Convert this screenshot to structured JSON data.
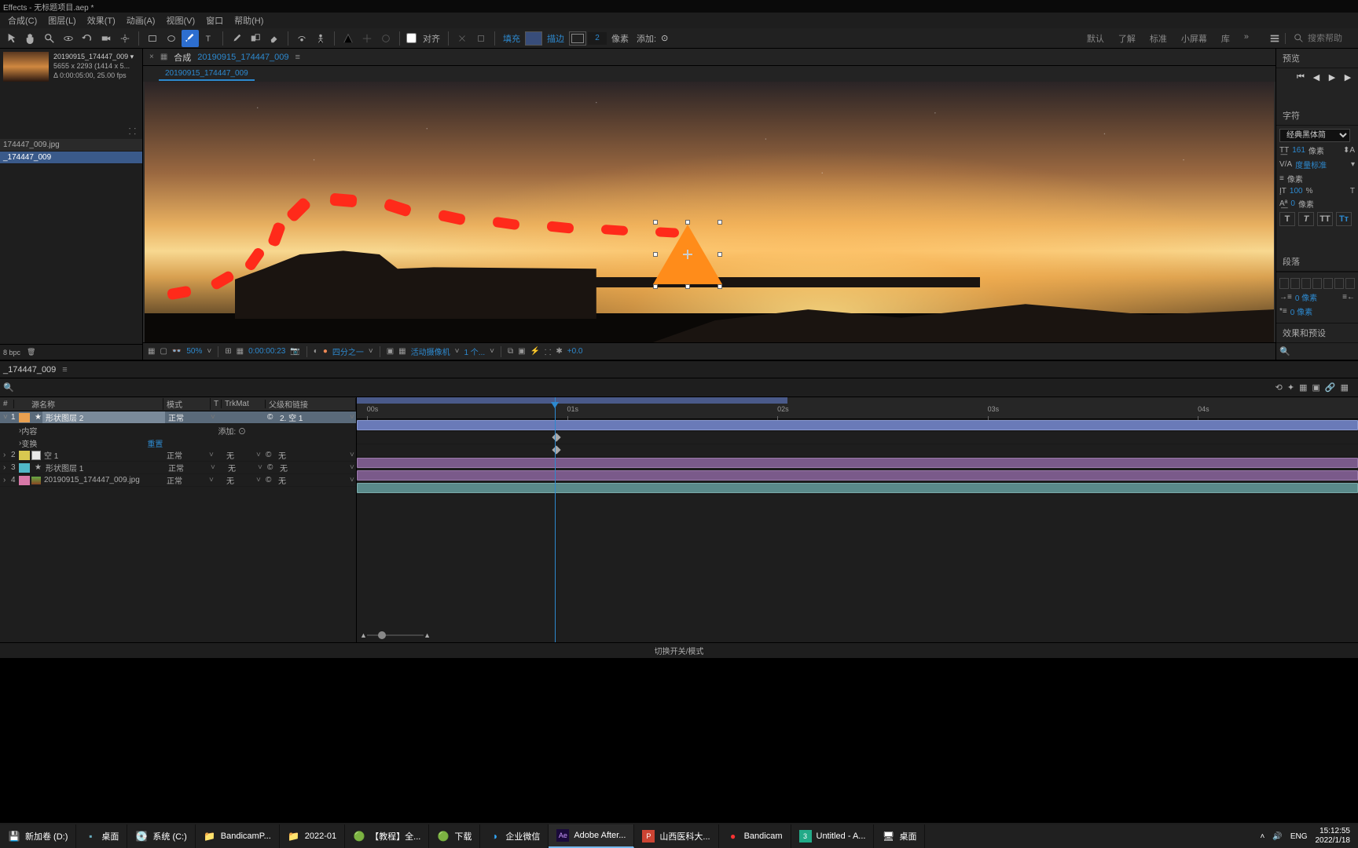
{
  "title": "Effects - 无标题项目.aep *",
  "menubar": [
    "合成(C)",
    "图层(L)",
    "效果(T)",
    "动画(A)",
    "视图(V)",
    "窗口",
    "帮助(H)"
  ],
  "toolbar": {
    "align": "对齐",
    "fill": "填充",
    "stroke": "描边",
    "stroke_width": "2",
    "pixels": "像素",
    "add": "添加:"
  },
  "workspaces": [
    "默认",
    "了解",
    "标准",
    "小屏幕",
    "库"
  ],
  "search_placeholder": "搜索帮助",
  "project": {
    "item_name": "20190915_174447_009",
    "dims": "5655 x 2293 (1414 x 5...",
    "duration": "Δ 0:00:05:00, 25.00 fps",
    "items": [
      "174447_009.jpg",
      "_174447_009"
    ],
    "bpc": "8 bpc"
  },
  "comp": {
    "prefix": "合成",
    "name": "20190915_174447_009",
    "tab": "20190915_174447_009",
    "zoom": "50%",
    "timecode": "0:00:00:23",
    "quality": "四分之一",
    "camera": "活动摄像机",
    "views": "1 个...",
    "offset": "+0.0"
  },
  "right": {
    "preview": "预览",
    "character": "字符",
    "font": "经典黑体简",
    "font_size": "161",
    "leading": "像素",
    "tracking_label": "度量标准",
    "kerning": "像素",
    "scale": "100",
    "percent": "%",
    "baseline": "0",
    "px": "像素",
    "paragraph": "段落",
    "indent": "0 像素",
    "effects": "效果和预设"
  },
  "timeline": {
    "comp_name": "_174447_009",
    "headers": {
      "num": "#",
      "source": "源名称",
      "mode": "模式",
      "t": "T",
      "trkmat": "TrkMat",
      "parent": "父级和链接"
    },
    "add": "添加:",
    "layers": [
      {
        "num": "1",
        "name": "形状图层 2",
        "mode": "正常",
        "parent": "2. 空 1",
        "color": "c-orange",
        "sel": true
      },
      {
        "num": "2",
        "name": "空 1",
        "mode": "正常",
        "trk": "无",
        "parent": "无",
        "color": "c-yellow",
        "icon": "white"
      },
      {
        "num": "3",
        "name": "形状图层 1",
        "mode": "正常",
        "trk": "无",
        "parent": "无",
        "color": "c-cyan",
        "icon": "star"
      },
      {
        "num": "4",
        "name": "20190915_174447_009.jpg",
        "mode": "正常",
        "trk": "无",
        "parent": "无",
        "color": "c-pink",
        "icon": "img"
      }
    ],
    "sub1": "内容",
    "sub2": "变换",
    "sub2_val": "重置",
    "ticks": [
      "00s",
      "01s",
      "02s",
      "03s",
      "04s"
    ],
    "footer": "切换开关/模式"
  },
  "taskbar": {
    "items": [
      {
        "label": "新加卷 (D:)"
      },
      {
        "label": "桌面"
      },
      {
        "label": "系统 (C:)"
      },
      {
        "label": "BandicamP..."
      },
      {
        "label": "2022-01"
      },
      {
        "label": "【教程】全..."
      },
      {
        "label": "下载"
      },
      {
        "label": "企业微信"
      },
      {
        "label": "Adobe After...",
        "active": true
      },
      {
        "label": "山西医科大..."
      },
      {
        "label": "Bandicam"
      },
      {
        "label": "Untitled - A..."
      },
      {
        "label": "桌面"
      }
    ],
    "tray": {
      "ime": "ENG",
      "time": "15:12:55",
      "date": "2022/1/18"
    }
  }
}
